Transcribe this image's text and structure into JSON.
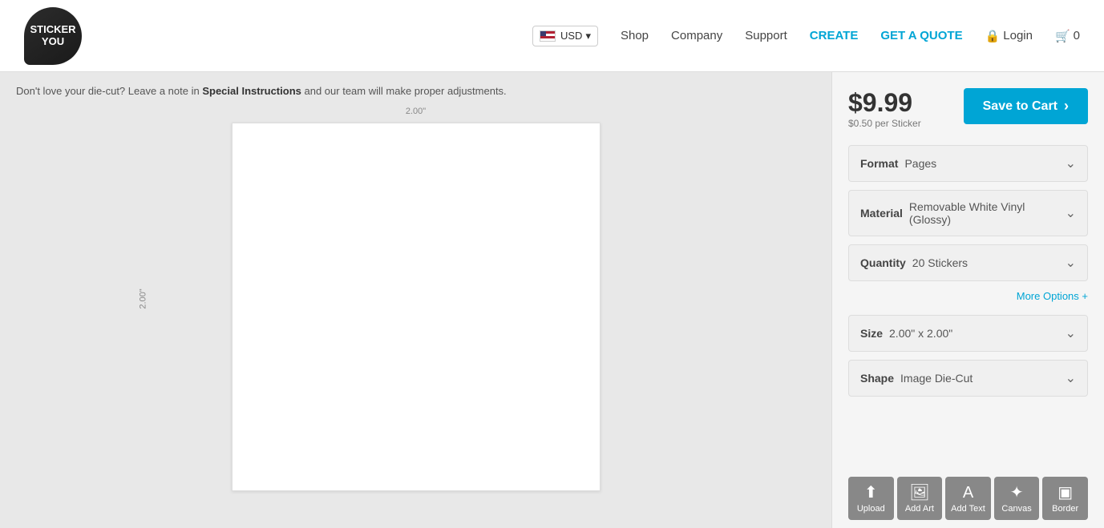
{
  "header": {
    "logo_line1": "STICKER",
    "logo_line2": "YOU",
    "nav": {
      "shop": "Shop",
      "company": "Company",
      "support": "Support",
      "create": "CREATE",
      "get_a_quote": "GET A QUOTE",
      "login": "Login",
      "cart_count": "0"
    },
    "currency": "USD"
  },
  "left_panel": {
    "notice": "Don't love your die-cut?",
    "notice_middle": " Leave a note in ",
    "notice_bold": "Special Instructions",
    "notice_end": " and our team will make proper adjustments.",
    "dimension_top": "2.00\"",
    "dimension_left": "2.00\""
  },
  "right_panel": {
    "price": "$9.99",
    "price_per": "$0.50 per Sticker",
    "save_btn_label": "Save to Cart",
    "format_label": "Format",
    "format_value": "Pages",
    "material_label": "Material",
    "material_value": "Removable White Vinyl (Glossy)",
    "quantity_label": "Quantity",
    "quantity_value": "20 Stickers",
    "size_label": "Size",
    "size_value": "2.00\" x 2.00\"",
    "shape_label": "Shape",
    "shape_value": "Image Die-Cut",
    "more_options": "More Options +",
    "toolbar": [
      {
        "id": "upload",
        "label": "Upload",
        "icon": "⬆"
      },
      {
        "id": "add_art",
        "label": "Add Art",
        "icon": "🖼"
      },
      {
        "id": "add_text",
        "label": "Add Text",
        "icon": "A"
      },
      {
        "id": "canvas",
        "label": "Canvas",
        "icon": "✦"
      },
      {
        "id": "border",
        "label": "Border",
        "icon": "▣"
      }
    ]
  }
}
